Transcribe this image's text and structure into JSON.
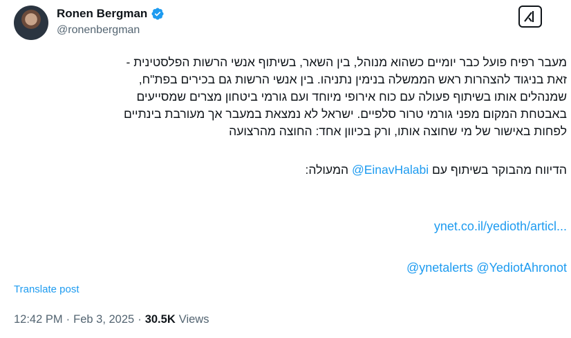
{
  "author": {
    "name": "Ronen Bergman",
    "handle": "@ronenbergman"
  },
  "post": {
    "paragraph1_lines": [
      "מעבר רפיח פועל כבר יומיים כשהוא מנוהל, בין השאר, בשיתוף אנשי הרשות הפלסטינית -",
      "זאת בניגוד להצהרות ראש הממשלה בנימין נתניהו. בין אנשי הרשות גם בכירים בפת\"ח,",
      "שמנהלים אותו בשיתוף פעולה עם כוח אירופי מיוחד ועם גורמי ביטחון מצרים שמסייעים",
      "באבטחת המקום מפני גורמי טרור סלפיים. ישראל לא נמצאת במעבר אך מעורבת בינתיים",
      "לפחות באישור של מי שחוצה אותו, ורק בכיוון אחד: החוצה מהרצועה"
    ],
    "paragraph2_prefix": "הדיווח מהבוקר בשיתוף עם",
    "paragraph2_mention": "@EinavHalabi",
    "paragraph2_suffix": "המעולה:",
    "link": "ynet.co.il/yedioth/articl...",
    "mentions": [
      "@ynetalerts",
      "@YediotAhronot"
    ]
  },
  "actions": {
    "translate": "Translate post"
  },
  "meta": {
    "time": "12:42 PM",
    "separator": "·",
    "date": "Feb 3, 2025",
    "views_count": "30.5K",
    "views_label": "Views"
  },
  "colors": {
    "accent": "#1d9bf0",
    "text": "#0f1419",
    "muted": "#536471"
  },
  "icons": {
    "verified": "verified-badge-icon",
    "grok": "grok-icon"
  }
}
